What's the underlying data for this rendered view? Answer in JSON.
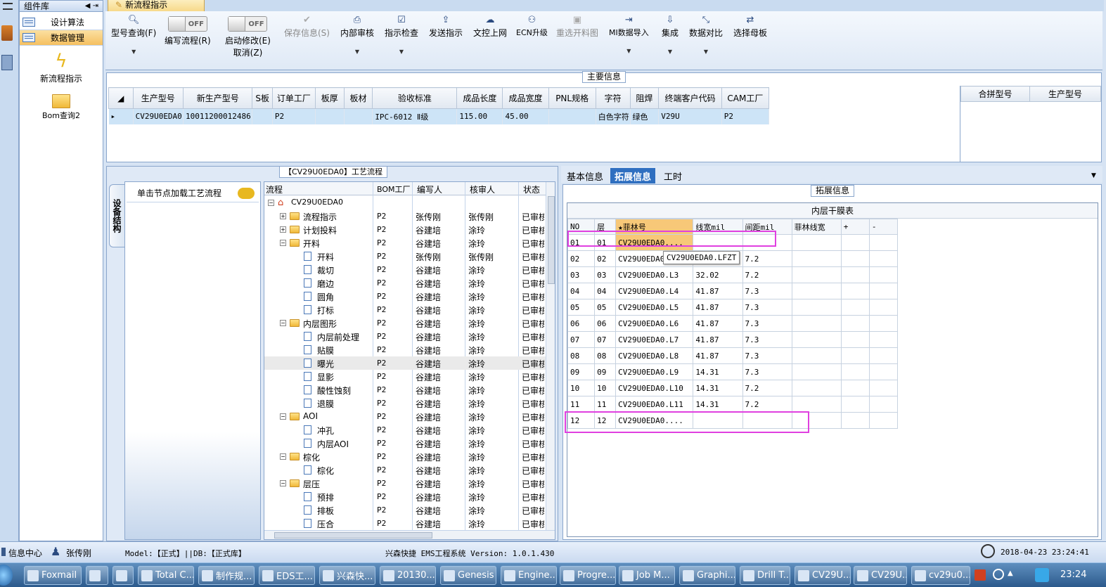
{
  "left_panel": {
    "title": "组件库",
    "nav": [
      {
        "label": "设计算法"
      },
      {
        "label": "数据管理"
      }
    ],
    "big_items": [
      {
        "label": "新流程指示"
      },
      {
        "label": "Bom查询2"
      }
    ]
  },
  "doc_tab": "新流程指示",
  "toolbar": {
    "query": "型号查询(F)",
    "write_flow": "编写流程(R)",
    "write_toggle": "OFF",
    "start_edit": "启动修改(E)",
    "start_toggle": "OFF",
    "cancel": "取消(Z)",
    "save": "保存信息(S)",
    "internal_review": "内部审核",
    "instruction_check": "指示检查",
    "send": "发送指示",
    "upload": "文控上网",
    "ecn": "ECN升级",
    "reselect": "重选开料图",
    "mi_import": "MI数据导入",
    "integrate": "集成",
    "compare": "数据对比",
    "choose_master": "选择母板"
  },
  "main_info": {
    "title": "主要信息",
    "columns": [
      "生产型号",
      "新生产型号",
      "S板",
      "订单工厂",
      "板厚",
      "板材",
      "验收标准",
      "成品长度",
      "成品宽度",
      "PNL规格",
      "字符",
      "阻焊",
      "终端客户代码",
      "CAM工厂"
    ],
    "row": [
      "CV29U0EDA0",
      "10011200012486",
      "",
      "P2",
      "",
      "",
      "IPC-6012 Ⅱ级",
      "115.00",
      "45.00",
      "",
      "白色字符",
      "绿色",
      "V29U",
      "P2"
    ],
    "side_columns": [
      "合拼型号",
      "生产型号"
    ]
  },
  "flow": {
    "title": "【CV29U0EDA0】工艺流程",
    "side_tab": "设备结构",
    "hint": "单击节点加载工艺流程",
    "columns": [
      "流程",
      "BOM工厂",
      "编写人",
      "核审人",
      "状态"
    ],
    "rows": [
      {
        "name": "CV29U0EDA0",
        "level": 0,
        "type": "root",
        "bom": "",
        "writer": "",
        "reviewer": "",
        "status": ""
      },
      {
        "name": "流程指示",
        "level": 1,
        "type": "folder",
        "bom": "P2",
        "writer": "张传刚",
        "reviewer": "张传刚",
        "status": "已审核"
      },
      {
        "name": "计划投料",
        "level": 1,
        "type": "folder",
        "bom": "P2",
        "writer": "谷建培",
        "reviewer": "涂玲",
        "status": "已审核"
      },
      {
        "name": "开料",
        "level": 1,
        "type": "folder",
        "bom": "P2",
        "writer": "谷建培",
        "reviewer": "涂玲",
        "status": "已审核"
      },
      {
        "name": "开料",
        "level": 2,
        "type": "page",
        "bom": "P2",
        "writer": "张传刚",
        "reviewer": "张传刚",
        "status": "已审核"
      },
      {
        "name": "裁切",
        "level": 2,
        "type": "page",
        "bom": "P2",
        "writer": "谷建培",
        "reviewer": "涂玲",
        "status": "已审核"
      },
      {
        "name": "磨边",
        "level": 2,
        "type": "page",
        "bom": "P2",
        "writer": "谷建培",
        "reviewer": "涂玲",
        "status": "已审核"
      },
      {
        "name": "圆角",
        "level": 2,
        "type": "page",
        "bom": "P2",
        "writer": "谷建培",
        "reviewer": "涂玲",
        "status": "已审核"
      },
      {
        "name": "打标",
        "level": 2,
        "type": "page",
        "bom": "P2",
        "writer": "谷建培",
        "reviewer": "涂玲",
        "status": "已审核"
      },
      {
        "name": "内层图形",
        "level": 1,
        "type": "folder",
        "bom": "P2",
        "writer": "谷建培",
        "reviewer": "涂玲",
        "status": "已审核"
      },
      {
        "name": "内层前处理",
        "level": 2,
        "type": "page",
        "bom": "P2",
        "writer": "谷建培",
        "reviewer": "涂玲",
        "status": "已审核"
      },
      {
        "name": "贴膜",
        "level": 2,
        "type": "page",
        "bom": "P2",
        "writer": "谷建培",
        "reviewer": "涂玲",
        "status": "已审核"
      },
      {
        "name": "曝光",
        "level": 2,
        "type": "page",
        "bom": "P2",
        "writer": "谷建培",
        "reviewer": "涂玲",
        "status": "已审核"
      },
      {
        "name": "显影",
        "level": 2,
        "type": "page",
        "bom": "P2",
        "writer": "谷建培",
        "reviewer": "涂玲",
        "status": "已审核"
      },
      {
        "name": "酸性蚀刻",
        "level": 2,
        "type": "page",
        "bom": "P2",
        "writer": "谷建培",
        "reviewer": "涂玲",
        "status": "已审核"
      },
      {
        "name": "退膜",
        "level": 2,
        "type": "page",
        "bom": "P2",
        "writer": "谷建培",
        "reviewer": "涂玲",
        "status": "已审核"
      },
      {
        "name": "AOI",
        "level": 1,
        "type": "folder",
        "bom": "P2",
        "writer": "谷建培",
        "reviewer": "涂玲",
        "status": "已审核"
      },
      {
        "name": "冲孔",
        "level": 2,
        "type": "page",
        "bom": "P2",
        "writer": "谷建培",
        "reviewer": "涂玲",
        "status": "已审核"
      },
      {
        "name": "内层AOI",
        "level": 2,
        "type": "page",
        "bom": "P2",
        "writer": "谷建培",
        "reviewer": "涂玲",
        "status": "已审核"
      },
      {
        "name": "棕化",
        "level": 1,
        "type": "folder",
        "bom": "P2",
        "writer": "谷建培",
        "reviewer": "涂玲",
        "status": "已审核"
      },
      {
        "name": "棕化",
        "level": 2,
        "type": "page",
        "bom": "P2",
        "writer": "谷建培",
        "reviewer": "涂玲",
        "status": "已审核"
      },
      {
        "name": "层压",
        "level": 1,
        "type": "folder",
        "bom": "P2",
        "writer": "谷建培",
        "reviewer": "涂玲",
        "status": "已审核"
      },
      {
        "name": "预排",
        "level": 2,
        "type": "page",
        "bom": "P2",
        "writer": "谷建培",
        "reviewer": "涂玲",
        "status": "已审核"
      },
      {
        "name": "排板",
        "level": 2,
        "type": "page",
        "bom": "P2",
        "writer": "谷建培",
        "reviewer": "涂玲",
        "status": "已审核"
      },
      {
        "name": "压合",
        "level": 2,
        "type": "page",
        "bom": "P2",
        "writer": "谷建培",
        "reviewer": "涂玲",
        "status": "已审核"
      }
    ]
  },
  "right_tabs": [
    "基本信息",
    "拓展信息",
    "工时"
  ],
  "ext": {
    "title": "拓展信息",
    "table_title": "内层干膜表",
    "columns": [
      "NO",
      "层",
      "★菲林号",
      "线宽mil",
      "间距mil",
      "菲林线宽",
      "+",
      "-"
    ],
    "rows": [
      [
        "01",
        "01",
        "CV29U0EDA0....",
        "",
        "",
        "",
        "",
        ""
      ],
      [
        "02",
        "02",
        "CV29U0EDA0.L2",
        "",
        "7.2",
        "",
        "",
        ""
      ],
      [
        "03",
        "03",
        "CV29U0EDA0.L3",
        "32.02",
        "7.2",
        "",
        "",
        ""
      ],
      [
        "04",
        "04",
        "CV29U0EDA0.L4",
        "41.87",
        "7.3",
        "",
        "",
        ""
      ],
      [
        "05",
        "05",
        "CV29U0EDA0.L5",
        "41.87",
        "7.3",
        "",
        "",
        ""
      ],
      [
        "06",
        "06",
        "CV29U0EDA0.L6",
        "41.87",
        "7.3",
        "",
        "",
        ""
      ],
      [
        "07",
        "07",
        "CV29U0EDA0.L7",
        "41.87",
        "7.3",
        "",
        "",
        ""
      ],
      [
        "08",
        "08",
        "CV29U0EDA0.L8",
        "41.87",
        "7.3",
        "",
        "",
        ""
      ],
      [
        "09",
        "09",
        "CV29U0EDA0.L9",
        "14.31",
        "7.3",
        "",
        "",
        ""
      ],
      [
        "10",
        "10",
        "CV29U0EDA0.L10",
        "14.31",
        "7.2",
        "",
        "",
        ""
      ],
      [
        "11",
        "11",
        "CV29U0EDA0.L11",
        "14.31",
        "7.2",
        "",
        "",
        ""
      ],
      [
        "12",
        "12",
        "CV29U0EDA0....",
        "",
        "",
        "",
        "",
        ""
      ]
    ],
    "tooltip": "CV29U0EDA0.LFZT"
  },
  "status": {
    "info": "信息中心",
    "user": "张传刚",
    "model": "Model:【正式】||DB:【正式库】",
    "system": "兴森快捷 EMS工程系统 Version: 1.0.1.430",
    "datetime": "2018-04-23 23:24:41"
  },
  "taskbar": {
    "items": [
      "Foxmail",
      "",
      "",
      "Total C...",
      "制作规...",
      "EDS工...",
      "兴森快...",
      "20130...",
      "Genesis",
      "Engine...",
      "Progre...",
      "Job M...",
      "Graphi...",
      "Drill T...",
      "CV29U...",
      "CV29U...",
      "cv29u0..."
    ],
    "time": "23:24"
  },
  "colors": {
    "highlight": "#e040e0",
    "selected_nav": "#f5c060",
    "selected_tab": "#2f6fc0"
  }
}
